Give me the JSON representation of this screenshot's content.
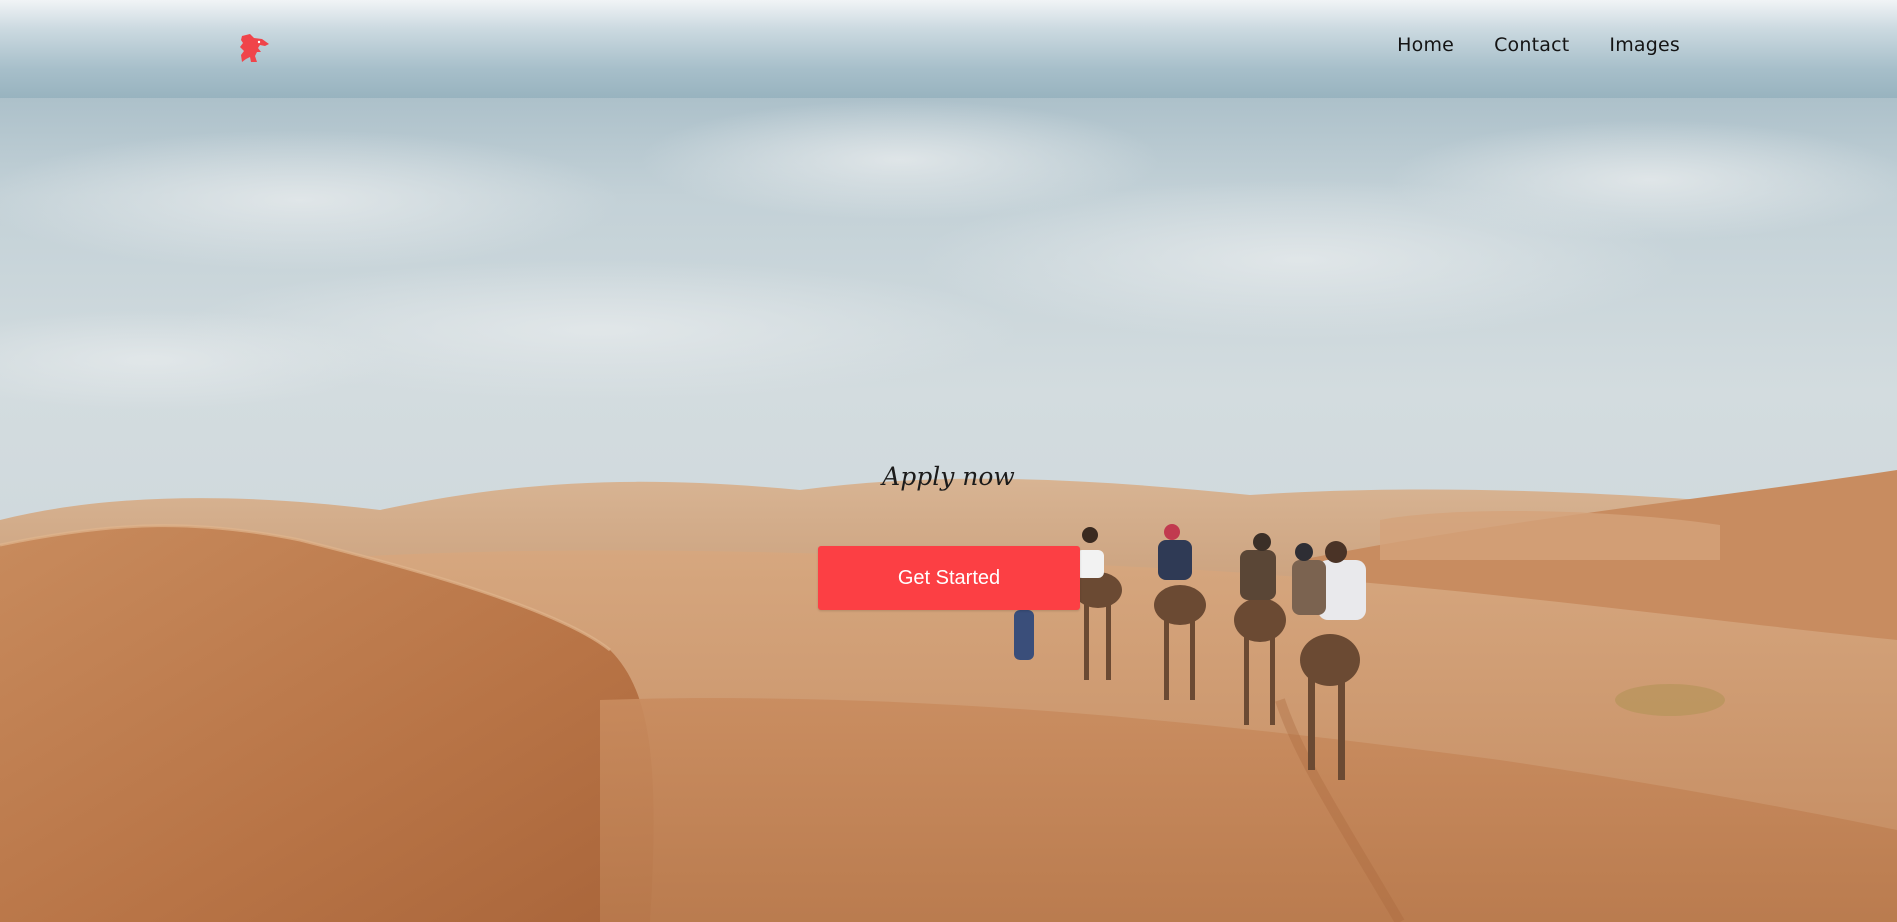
{
  "nav": {
    "items": [
      {
        "label": "Home"
      },
      {
        "label": "Contact"
      },
      {
        "label": "Images"
      }
    ]
  },
  "hero": {
    "title": "Apply now",
    "cta_label": "Get Started"
  },
  "theme": {
    "accent": "#fc3f44",
    "logo_color": "#f0444a"
  },
  "icons": {
    "logo": "dragon-logo-icon"
  }
}
